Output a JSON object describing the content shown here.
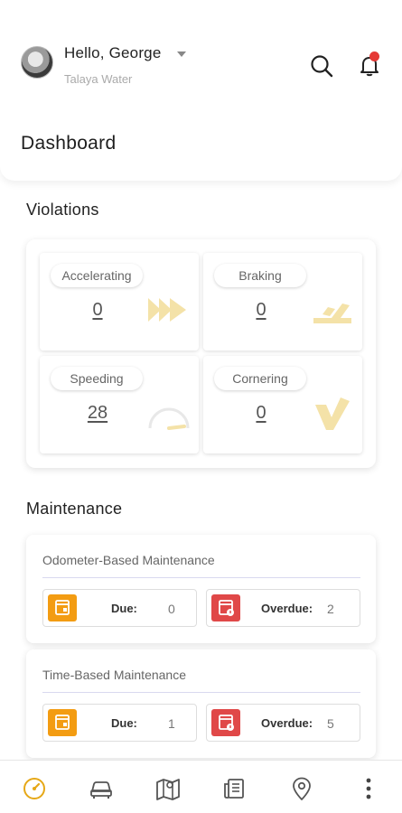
{
  "header": {
    "greeting": "Hello, George",
    "company": "Talaya Water",
    "page_title": "Dashboard"
  },
  "violations": {
    "title": "Violations",
    "tiles": [
      {
        "label": "Accelerating",
        "value": "0",
        "icon": "fast-forward-icon"
      },
      {
        "label": "Braking",
        "value": "0",
        "icon": "braking-icon"
      },
      {
        "label": "Speeding",
        "value": "28",
        "icon": "speedometer-icon"
      },
      {
        "label": "Cornering",
        "value": "0",
        "icon": "cornering-icon"
      }
    ]
  },
  "maintenance": {
    "title": "Maintenance",
    "cards": [
      {
        "title": "Odometer-Based Maintenance",
        "due_label": "Due:",
        "due_value": "0",
        "overdue_label": "Overdue:",
        "overdue_value": "2"
      },
      {
        "title": "Time-Based Maintenance",
        "due_label": "Due:",
        "due_value": "1",
        "overdue_label": "Overdue:",
        "overdue_value": "5"
      }
    ]
  },
  "nav": {
    "items": [
      "dashboard-icon",
      "vehicle-icon",
      "map-icon",
      "report-icon",
      "location-pin-icon",
      "more-icon"
    ],
    "active_color": "#e6a817",
    "icon_color": "#555555"
  },
  "colors": {
    "due": "#f39c12",
    "overdue": "#e04848",
    "notification": "#e53935",
    "violation_icon": "#f4e2a8"
  }
}
